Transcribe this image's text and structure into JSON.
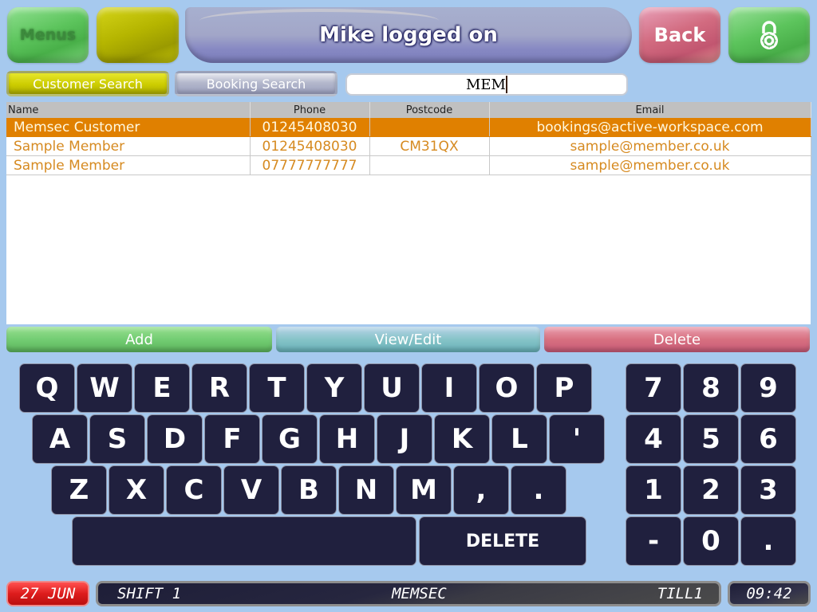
{
  "header": {
    "menus_label": "Menus",
    "blank_button_label": "",
    "title": "Mike logged on",
    "back_label": "Back",
    "lock_icon": "padlock-icon"
  },
  "search": {
    "tabs": [
      {
        "label": "Customer Search",
        "active": true
      },
      {
        "label": "Booking Search",
        "active": false
      }
    ],
    "value": "MEM"
  },
  "results": {
    "columns": [
      "Name",
      "Phone",
      "Postcode",
      "Email"
    ],
    "rows": [
      {
        "name": "Memsec Customer",
        "phone": "01245408030",
        "postcode": "",
        "email": "bookings@active-workspace.com",
        "selected": true
      },
      {
        "name": "Sample Member",
        "phone": "01245408030",
        "postcode": "CM31QX",
        "email": "sample@member.co.uk",
        "selected": false
      },
      {
        "name": "Sample Member",
        "phone": "07777777777",
        "postcode": "",
        "email": "sample@member.co.uk",
        "selected": false
      }
    ]
  },
  "actions": {
    "add": "Add",
    "view_edit": "View/Edit",
    "delete": "Delete"
  },
  "keyboard": {
    "row1": [
      "Q",
      "W",
      "E",
      "R",
      "T",
      "Y",
      "U",
      "I",
      "O",
      "P"
    ],
    "row2": [
      "A",
      "S",
      "D",
      "F",
      "G",
      "H",
      "J",
      "K",
      "L",
      "'"
    ],
    "row3": [
      "Z",
      "X",
      "C",
      "V",
      "B",
      "N",
      "M",
      ",",
      "."
    ],
    "space_label": "",
    "delete_label": "DELETE",
    "numpad": [
      [
        "7",
        "8",
        "9"
      ],
      [
        "4",
        "5",
        "6"
      ],
      [
        "1",
        "2",
        "3"
      ],
      [
        "-",
        "0",
        "."
      ]
    ]
  },
  "status": {
    "date": "27 JUN",
    "shift": "SHIFT 1",
    "site": "MEMSEC",
    "till": "TILL1",
    "time": "09:42"
  },
  "colors": {
    "background": "#a6c9ee",
    "selected_row": "#e08000",
    "row_text": "#d68a20",
    "key_bg": "#20203e"
  }
}
